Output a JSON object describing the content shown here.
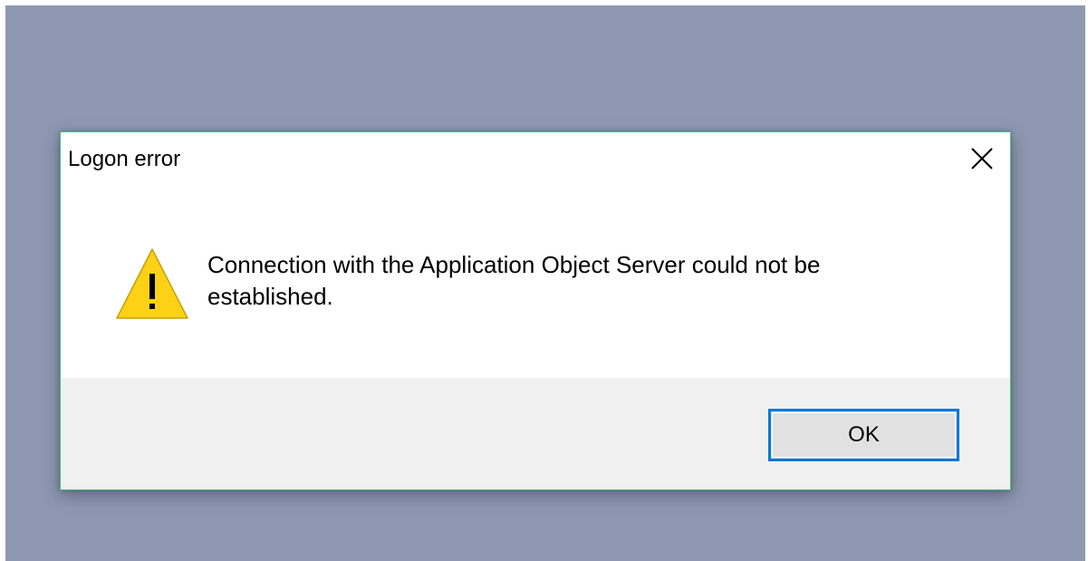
{
  "dialog": {
    "title": "Logon error",
    "message": "Connection with the Application Object Server could not be established.",
    "icon": "warning-icon",
    "close_icon": "close-icon",
    "ok_label": "OK"
  },
  "colors": {
    "desktop_background": "#8f98b1",
    "dialog_border": "#3cc37a",
    "footer_background": "#f0f0f0",
    "button_focus_border": "#0078d7",
    "warning_yellow": "#fcd116"
  }
}
